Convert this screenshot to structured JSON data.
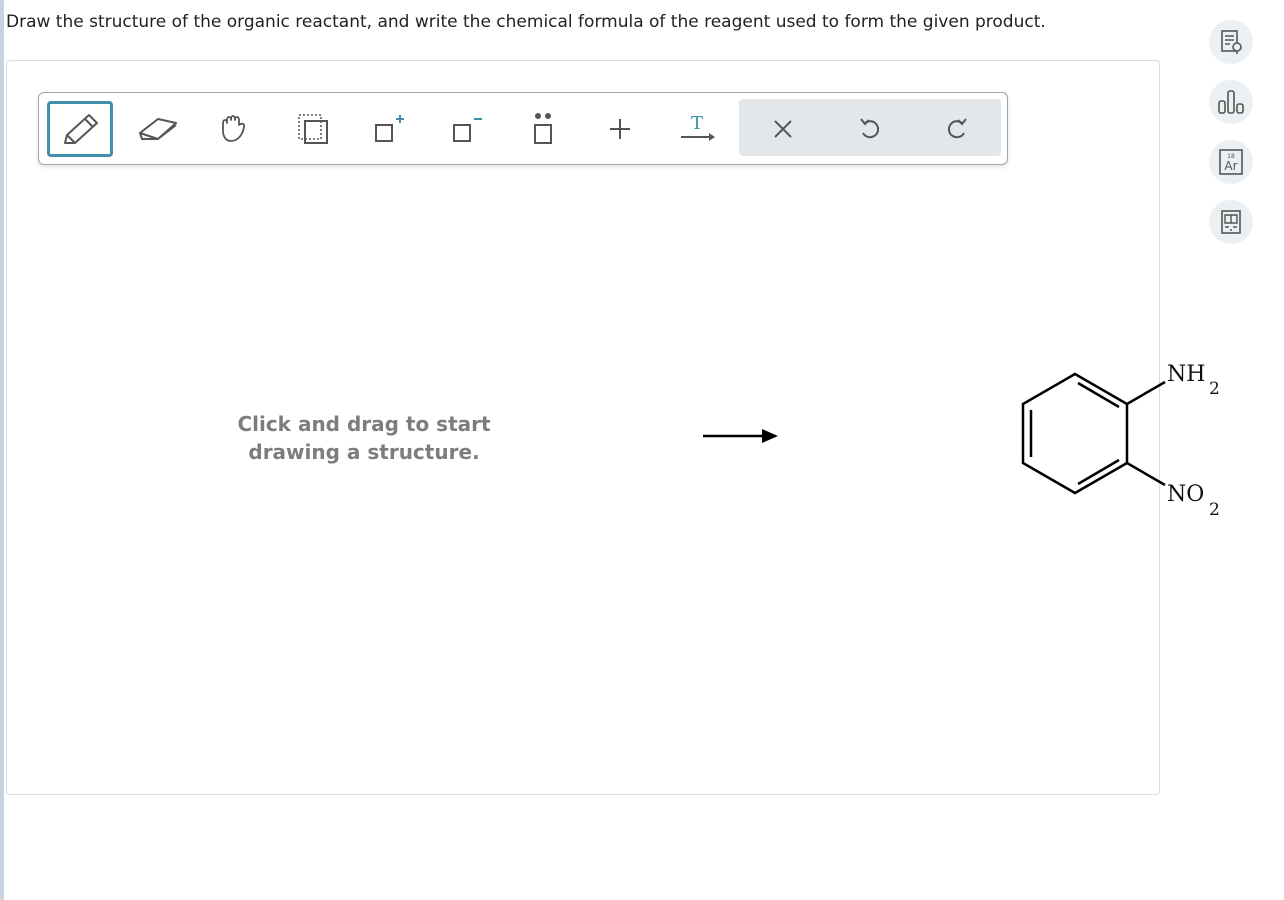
{
  "question": {
    "text": "Draw the structure of the organic reactant, and write the chemical formula of the reagent used to form the given product."
  },
  "toolbar": {
    "tools": [
      {
        "name": "pencil-tool",
        "icon": "pencil-icon",
        "selected": true
      },
      {
        "name": "eraser-tool",
        "icon": "eraser-icon",
        "selected": false
      },
      {
        "name": "hand-tool",
        "icon": "hand-icon",
        "selected": false
      },
      {
        "name": "select-tool",
        "icon": "dashed-select-icon",
        "selected": false
      },
      {
        "name": "positive-charge-tool",
        "icon": "plus-charge-icon",
        "selected": false
      },
      {
        "name": "negative-charge-tool",
        "icon": "minus-charge-icon",
        "selected": false
      },
      {
        "name": "lone-pair-tool",
        "icon": "lone-pair-icon",
        "selected": false
      },
      {
        "name": "add-plus-tool",
        "icon": "plus-icon",
        "selected": false
      },
      {
        "name": "reaction-arrow-text-tool",
        "icon": "text-arrow-icon",
        "text": "T",
        "selected": false
      },
      {
        "name": "clear-tool",
        "icon": "x-icon",
        "selected": false
      },
      {
        "name": "undo-tool",
        "icon": "undo-icon",
        "selected": false
      },
      {
        "name": "redo-tool",
        "icon": "redo-icon",
        "selected": false
      }
    ],
    "accent_color": "#3f8fa8"
  },
  "canvas": {
    "placeholder_line1": "Click and drag to start",
    "placeholder_line2": "drawing a structure."
  },
  "product": {
    "substituent_top": "NH",
    "substituent_top_sub": "2",
    "substituent_bottom": "NO",
    "substituent_bottom_sub": "2",
    "ring": "benzene"
  },
  "side_panel": [
    {
      "name": "explanation-button",
      "icon": "document-search-icon"
    },
    {
      "name": "data-button",
      "icon": "bar-chart-icon"
    },
    {
      "name": "periodic-table-button",
      "icon": "periodic-element-icon",
      "number": "18",
      "symbol": "Ar"
    },
    {
      "name": "calculator-button",
      "icon": "book-icon"
    }
  ]
}
